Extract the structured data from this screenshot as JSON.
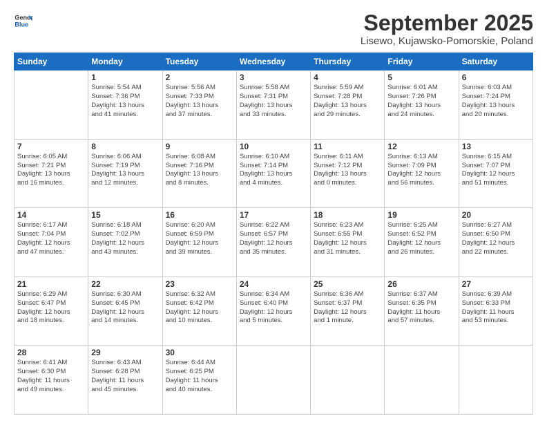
{
  "logo": {
    "line1": "General",
    "line2": "Blue"
  },
  "title": "September 2025",
  "location": "Lisewo, Kujawsko-Pomorskie, Poland",
  "weekdays": [
    "Sunday",
    "Monday",
    "Tuesday",
    "Wednesday",
    "Thursday",
    "Friday",
    "Saturday"
  ],
  "weeks": [
    [
      {
        "day": "",
        "info": ""
      },
      {
        "day": "1",
        "info": "Sunrise: 5:54 AM\nSunset: 7:36 PM\nDaylight: 13 hours\nand 41 minutes."
      },
      {
        "day": "2",
        "info": "Sunrise: 5:56 AM\nSunset: 7:33 PM\nDaylight: 13 hours\nand 37 minutes."
      },
      {
        "day": "3",
        "info": "Sunrise: 5:58 AM\nSunset: 7:31 PM\nDaylight: 13 hours\nand 33 minutes."
      },
      {
        "day": "4",
        "info": "Sunrise: 5:59 AM\nSunset: 7:28 PM\nDaylight: 13 hours\nand 29 minutes."
      },
      {
        "day": "5",
        "info": "Sunrise: 6:01 AM\nSunset: 7:26 PM\nDaylight: 13 hours\nand 24 minutes."
      },
      {
        "day": "6",
        "info": "Sunrise: 6:03 AM\nSunset: 7:24 PM\nDaylight: 13 hours\nand 20 minutes."
      }
    ],
    [
      {
        "day": "7",
        "info": "Sunrise: 6:05 AM\nSunset: 7:21 PM\nDaylight: 13 hours\nand 16 minutes."
      },
      {
        "day": "8",
        "info": "Sunrise: 6:06 AM\nSunset: 7:19 PM\nDaylight: 13 hours\nand 12 minutes."
      },
      {
        "day": "9",
        "info": "Sunrise: 6:08 AM\nSunset: 7:16 PM\nDaylight: 13 hours\nand 8 minutes."
      },
      {
        "day": "10",
        "info": "Sunrise: 6:10 AM\nSunset: 7:14 PM\nDaylight: 13 hours\nand 4 minutes."
      },
      {
        "day": "11",
        "info": "Sunrise: 6:11 AM\nSunset: 7:12 PM\nDaylight: 13 hours\nand 0 minutes."
      },
      {
        "day": "12",
        "info": "Sunrise: 6:13 AM\nSunset: 7:09 PM\nDaylight: 12 hours\nand 56 minutes."
      },
      {
        "day": "13",
        "info": "Sunrise: 6:15 AM\nSunset: 7:07 PM\nDaylight: 12 hours\nand 51 minutes."
      }
    ],
    [
      {
        "day": "14",
        "info": "Sunrise: 6:17 AM\nSunset: 7:04 PM\nDaylight: 12 hours\nand 47 minutes."
      },
      {
        "day": "15",
        "info": "Sunrise: 6:18 AM\nSunset: 7:02 PM\nDaylight: 12 hours\nand 43 minutes."
      },
      {
        "day": "16",
        "info": "Sunrise: 6:20 AM\nSunset: 6:59 PM\nDaylight: 12 hours\nand 39 minutes."
      },
      {
        "day": "17",
        "info": "Sunrise: 6:22 AM\nSunset: 6:57 PM\nDaylight: 12 hours\nand 35 minutes."
      },
      {
        "day": "18",
        "info": "Sunrise: 6:23 AM\nSunset: 6:55 PM\nDaylight: 12 hours\nand 31 minutes."
      },
      {
        "day": "19",
        "info": "Sunrise: 6:25 AM\nSunset: 6:52 PM\nDaylight: 12 hours\nand 26 minutes."
      },
      {
        "day": "20",
        "info": "Sunrise: 6:27 AM\nSunset: 6:50 PM\nDaylight: 12 hours\nand 22 minutes."
      }
    ],
    [
      {
        "day": "21",
        "info": "Sunrise: 6:29 AM\nSunset: 6:47 PM\nDaylight: 12 hours\nand 18 minutes."
      },
      {
        "day": "22",
        "info": "Sunrise: 6:30 AM\nSunset: 6:45 PM\nDaylight: 12 hours\nand 14 minutes."
      },
      {
        "day": "23",
        "info": "Sunrise: 6:32 AM\nSunset: 6:42 PM\nDaylight: 12 hours\nand 10 minutes."
      },
      {
        "day": "24",
        "info": "Sunrise: 6:34 AM\nSunset: 6:40 PM\nDaylight: 12 hours\nand 5 minutes."
      },
      {
        "day": "25",
        "info": "Sunrise: 6:36 AM\nSunset: 6:37 PM\nDaylight: 12 hours\nand 1 minute."
      },
      {
        "day": "26",
        "info": "Sunrise: 6:37 AM\nSunset: 6:35 PM\nDaylight: 11 hours\nand 57 minutes."
      },
      {
        "day": "27",
        "info": "Sunrise: 6:39 AM\nSunset: 6:33 PM\nDaylight: 11 hours\nand 53 minutes."
      }
    ],
    [
      {
        "day": "28",
        "info": "Sunrise: 6:41 AM\nSunset: 6:30 PM\nDaylight: 11 hours\nand 49 minutes."
      },
      {
        "day": "29",
        "info": "Sunrise: 6:43 AM\nSunset: 6:28 PM\nDaylight: 11 hours\nand 45 minutes."
      },
      {
        "day": "30",
        "info": "Sunrise: 6:44 AM\nSunset: 6:25 PM\nDaylight: 11 hours\nand 40 minutes."
      },
      {
        "day": "",
        "info": ""
      },
      {
        "day": "",
        "info": ""
      },
      {
        "day": "",
        "info": ""
      },
      {
        "day": "",
        "info": ""
      }
    ]
  ]
}
